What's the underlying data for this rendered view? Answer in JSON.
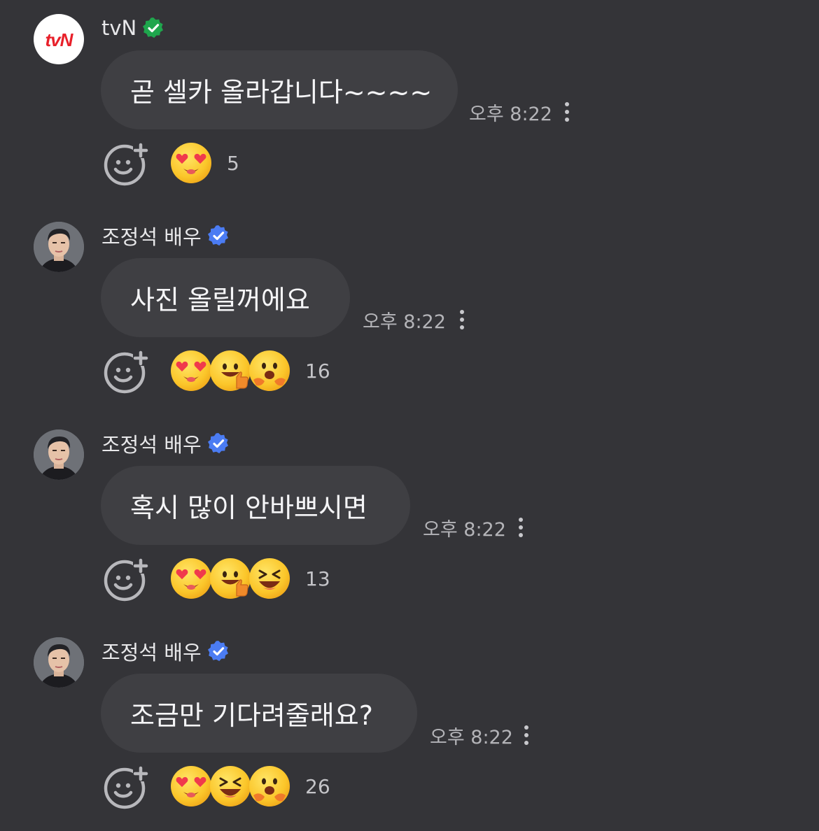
{
  "colors": {
    "background": "#343438",
    "bubble": "#3f3f43",
    "verified_brand": "#1fa64d",
    "verified_person": "#4b7cf3",
    "brand_logo": "#e8202a"
  },
  "messages": [
    {
      "sender": "tvN",
      "avatar": "tvn-logo",
      "verified_icon": "verified-green-icon",
      "text": "곧 셀카 올라갑니다~~~~",
      "time": "오후 8:22",
      "reactions": [
        "heart-eyes",
        "",
        ""
      ],
      "reaction_count": "5"
    },
    {
      "sender": "조정석 배우",
      "avatar": "actor-photo",
      "verified_icon": "verified-blue-icon",
      "text": "사진 올릴꺼에요",
      "time": "오후 8:22",
      "reactions": [
        "heart-eyes",
        "thumbs-up-face",
        "hugging-face"
      ],
      "reaction_count": "16"
    },
    {
      "sender": "조정석 배우",
      "avatar": "actor-photo",
      "verified_icon": "verified-blue-icon",
      "text": "혹시 많이 안바쁘시면",
      "time": "오후 8:22",
      "reactions": [
        "heart-eyes",
        "thumbs-up-face",
        "laughing-face"
      ],
      "reaction_count": "13"
    },
    {
      "sender": "조정석 배우",
      "avatar": "actor-photo",
      "verified_icon": "verified-blue-icon",
      "text": "조금만 기다려줄래요?",
      "time": "오후 8:22",
      "reactions": [
        "heart-eyes",
        "laughing-face",
        "hugging-face"
      ],
      "reaction_count": "26"
    }
  ]
}
